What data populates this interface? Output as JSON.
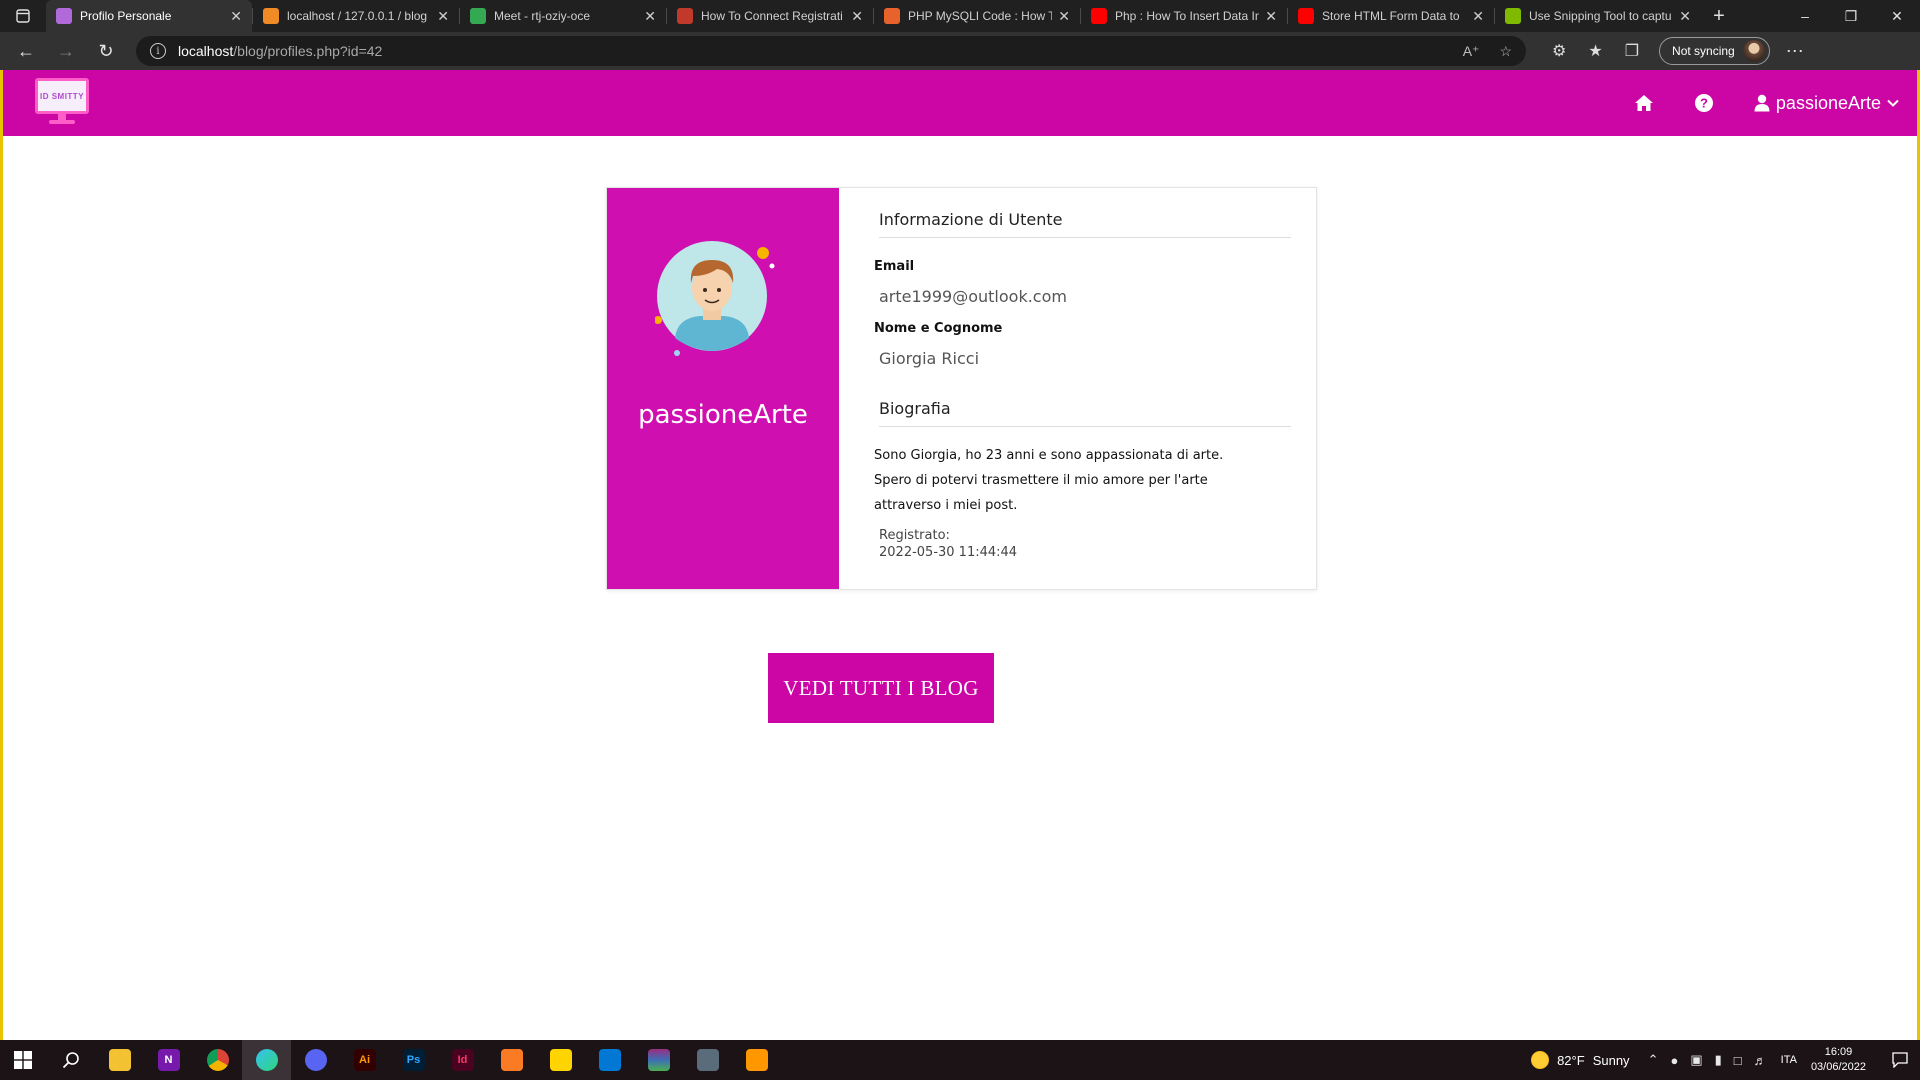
{
  "browser": {
    "tabs": [
      {
        "label": "Profilo Personale",
        "active": true,
        "favicon_color": "#b06ad9"
      },
      {
        "label": "localhost / 127.0.0.1 / blog",
        "active": false,
        "favicon_color": "#f08a24"
      },
      {
        "label": "Meet - rtj-oziy-oce",
        "active": false,
        "favicon_color": "#34a853"
      },
      {
        "label": "How To Connect Registrati",
        "active": false,
        "favicon_color": "#c0392b"
      },
      {
        "label": "PHP MySQLI Code : How T",
        "active": false,
        "favicon_color": "#e8632b"
      },
      {
        "label": "Php : How To Insert Data In",
        "active": false,
        "favicon_color": "#ff0000"
      },
      {
        "label": "Store HTML Form Data to",
        "active": false,
        "favicon_color": "#ff0000"
      },
      {
        "label": "Use Snipping Tool to captu",
        "active": false,
        "favicon_color": "#7fba00"
      }
    ],
    "address": {
      "host": "localhost",
      "path": "/blog/profiles.php?id=42"
    },
    "sync_label": "Not syncing"
  },
  "site": {
    "brand_color": "#cc06a5",
    "logo_text": "ID SMITTY",
    "nav": {
      "home_icon": "home-icon",
      "help_icon": "question-circle-icon",
      "user_label": "passioneArte"
    }
  },
  "profile": {
    "username": "passioneArte",
    "section_info_title": "Informazione di Utente",
    "email_label": "Email",
    "email_value": "arte1999@outlook.com",
    "name_label": "Nome e Cognome",
    "name_value": "Giorgia Ricci",
    "bio_title": "Biografia",
    "bio_lines": [
      "Sono Giorgia, ho 23 anni e sono appassionata di arte.",
      "Spero di potervi trasmettere il mio amore per l'arte",
      "attraverso i miei post."
    ],
    "registered_label": "Registrato:",
    "registered_value": "2022-05-30 11:44:44"
  },
  "cta": {
    "label": "VEDI TUTTI I BLOG"
  },
  "taskbar": {
    "weather_temp": "82°F",
    "weather_desc": "Sunny",
    "language": "ITA",
    "time": "16:09",
    "date": "03/06/2022"
  }
}
